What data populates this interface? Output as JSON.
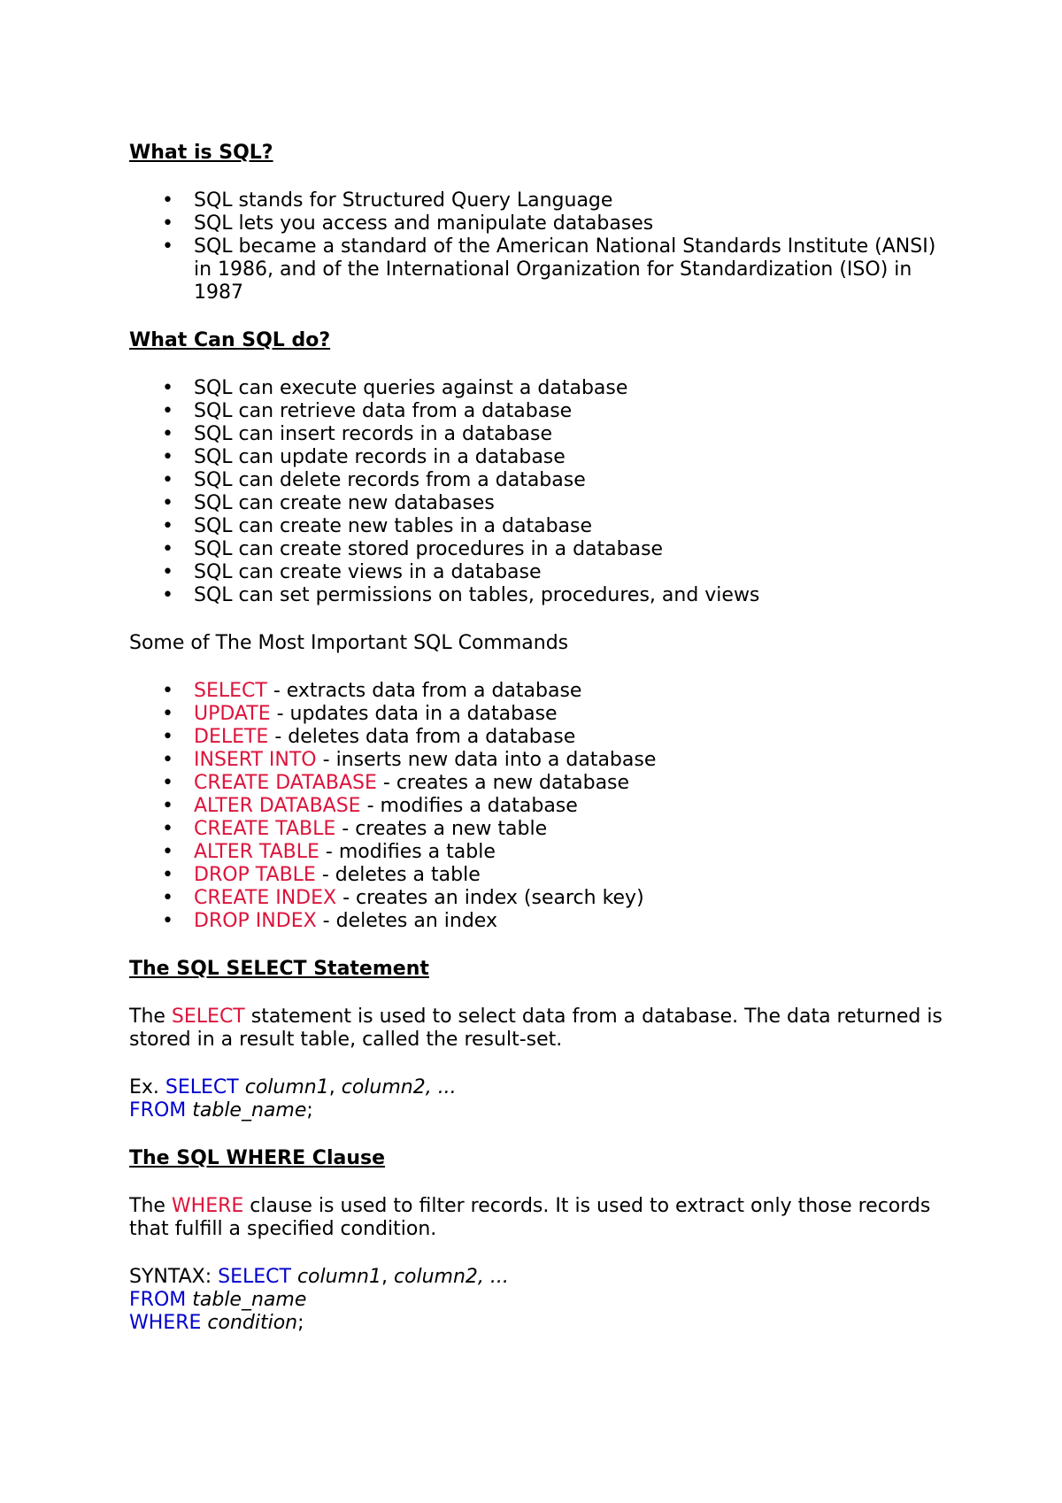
{
  "sections": {
    "what_is": {
      "heading": "What is SQL?",
      "items": [
        "SQL stands for Structured Query Language",
        "SQL lets you access and manipulate databases",
        "SQL became a standard of the American National Standards Institute (ANSI) in 1986, and of the International Organization for Standardization (ISO) in 1987"
      ]
    },
    "can_do": {
      "heading": "What Can SQL do?",
      "items": [
        "SQL can execute queries against a database",
        "SQL can retrieve data from a database",
        "SQL can insert records in a database",
        "SQL can update records in a database",
        "SQL can delete records from a database",
        "SQL can create new databases",
        "SQL can create new tables in a database",
        "SQL can create stored procedures in a database",
        "SQL can create views in a database",
        "SQL can set permissions on tables, procedures, and views"
      ]
    },
    "commands": {
      "intro": "Some of The Most Important SQL Commands",
      "items": [
        {
          "cmd": "SELECT",
          "desc": " - extracts data from a database"
        },
        {
          "cmd": "UPDATE",
          "desc": " - updates data in a database"
        },
        {
          "cmd": "DELETE",
          "desc": " - deletes data from a database"
        },
        {
          "cmd": "INSERT INTO",
          "desc": " - inserts new data into a database"
        },
        {
          "cmd": "CREATE DATABASE",
          "desc": " - creates a new database"
        },
        {
          "cmd": "ALTER DATABASE",
          "desc": " - modifies a database"
        },
        {
          "cmd": "CREATE TABLE",
          "desc": " - creates a new table"
        },
        {
          "cmd": "ALTER TABLE",
          "desc": " - modifies a table"
        },
        {
          "cmd": "DROP TABLE",
          "desc": " - deletes a table"
        },
        {
          "cmd": "CREATE INDEX",
          "desc": " - creates an index (search key)"
        },
        {
          "cmd": "DROP INDEX",
          "desc": " - deletes an index"
        }
      ]
    },
    "select_stmt": {
      "heading": "The SQL SELECT Statement",
      "para_pre": "The ",
      "para_kw": "SELECT",
      "para_post": " statement is used to select data from a database. The data returned is stored in a result table, called the result-set.",
      "ex_label": "Ex. ",
      "kw_select": "SELECT",
      "cols": "column1",
      "cols_sep": ", ",
      "cols2": "column2, ...",
      "kw_from": "FROM",
      "table": "table_name",
      "semi": ";"
    },
    "where_clause": {
      "heading": "The SQL WHERE Clause",
      "para_pre": "The ",
      "para_kw": "WHERE",
      "para_post": " clause is used to filter records. It is used to extract only those records that fulfill a specified condition.",
      "syntax_label": "SYNTAX: ",
      "kw_select": "SELECT",
      "cols": "column1",
      "cols_sep": ", ",
      "cols2": "column2, ...",
      "kw_from": "FROM",
      "table": "table_name",
      "kw_where": "WHERE",
      "condition": "condition",
      "semi": ";"
    }
  },
  "colors": {
    "keyword_red": "#dc143c",
    "keyword_blue": "#0000cd"
  },
  "bullet_glyph": "•"
}
